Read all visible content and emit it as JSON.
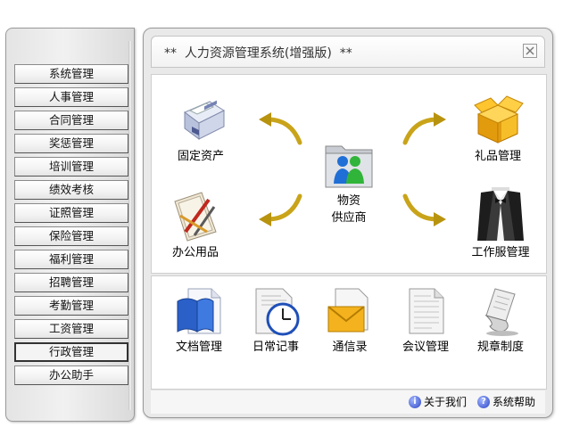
{
  "nav": {
    "items": [
      "系统管理",
      "人事管理",
      "合同管理",
      "奖惩管理",
      "培训管理",
      "绩效考核",
      "证照管理",
      "保险管理",
      "福利管理",
      "招聘管理",
      "考勤管理",
      "工资管理",
      "行政管理",
      "办公助手"
    ],
    "active": "行政管理"
  },
  "window": {
    "title": "**  人力资源管理系统(增强版)  **"
  },
  "center": {
    "label_line1": "物资",
    "label_line2": "供应商"
  },
  "upper_icons": {
    "fixed_assets": "固定资产",
    "gifts": "礼品管理",
    "office_supplies": "办公用品",
    "uniforms": "工作服管理"
  },
  "lower_icons": [
    "文档管理",
    "日常记事",
    "通信录",
    "会议管理",
    "规章制度"
  ],
  "footer": {
    "about": "关于我们",
    "help": "系统帮助"
  },
  "icons": {
    "fixed_assets": "printer-icon",
    "gifts": "gift-box-icon",
    "office_supplies": "stationery-icon",
    "uniforms": "tuxedo-icon",
    "supplier": "people-folder-icon",
    "documents": "book-document-icon",
    "notes": "clock-document-icon",
    "contacts": "envelope-icon",
    "meetings": "document-icon",
    "rules": "scroll-icon"
  },
  "colors": {
    "accent_blue": "#8ea1e2",
    "arrow_gold": "#c9a41a",
    "gift_gold": "#f2b81c"
  }
}
